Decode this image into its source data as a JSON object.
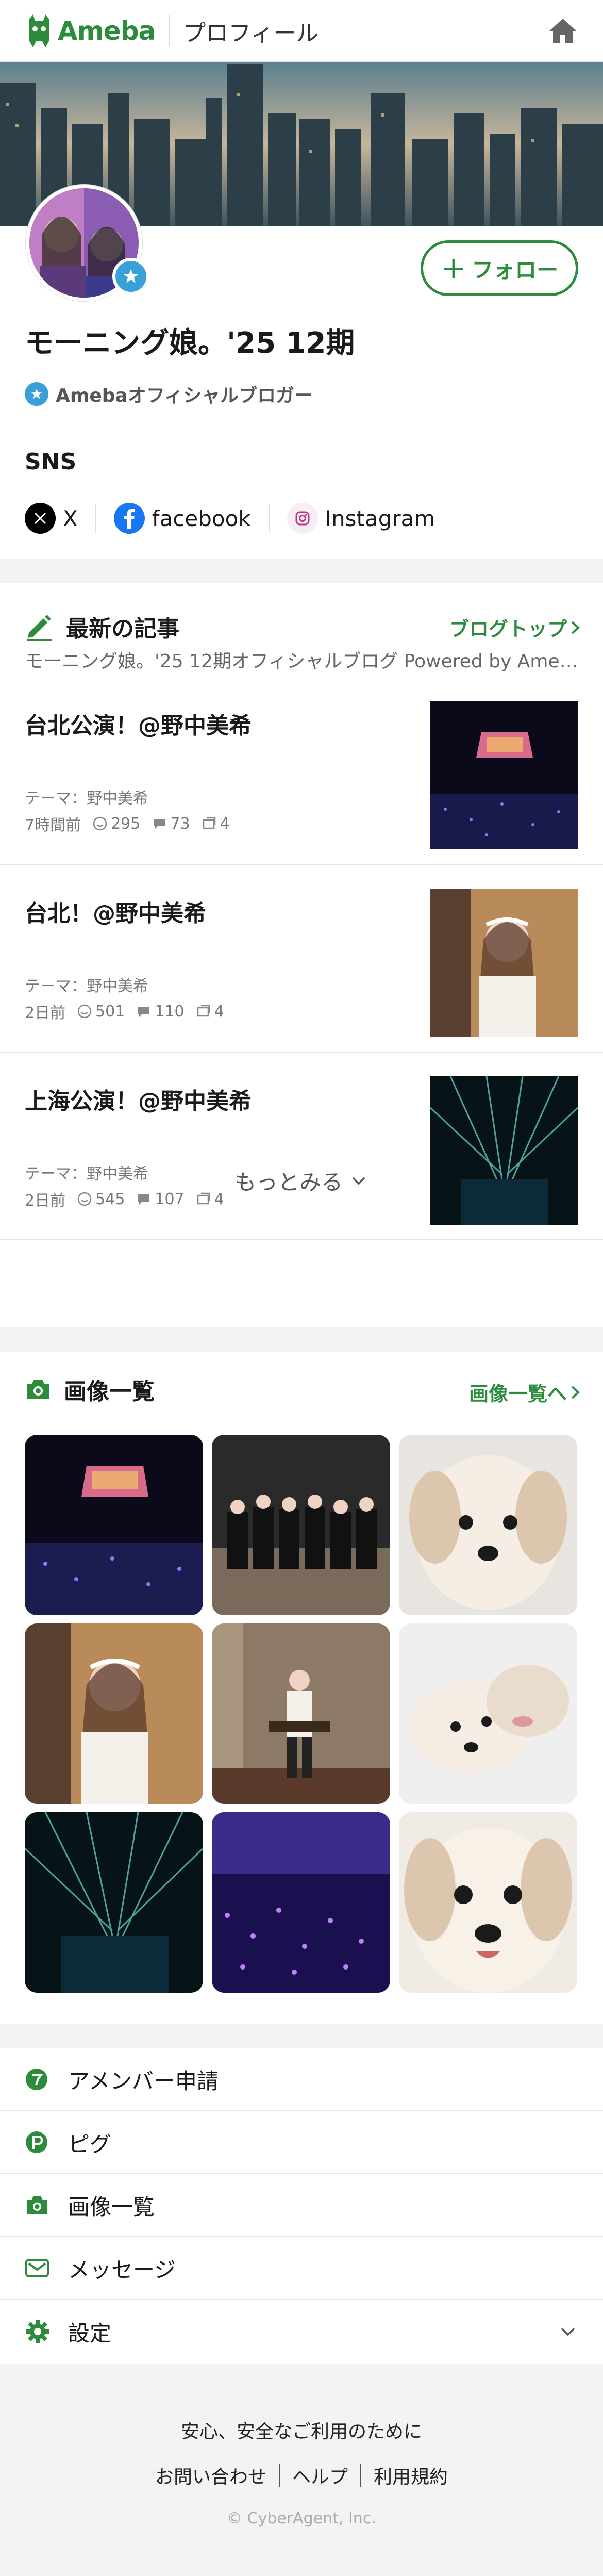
{
  "header": {
    "logo_text": "Ameba",
    "title": "プロフィール"
  },
  "profile": {
    "follow_label": "フォロー",
    "name": "モーニング娘。'25 12期",
    "official_label": "Amebaオフィシャルブロガー"
  },
  "sns": {
    "title": "SNS",
    "items": [
      {
        "label": "X",
        "icon": "x-icon"
      },
      {
        "label": "facebook",
        "icon": "facebook-icon"
      },
      {
        "label": "Instagram",
        "icon": "instagram-icon"
      }
    ]
  },
  "articles": {
    "title": "最新の記事",
    "link": "ブログトップ",
    "subtitle": "モーニング娘。'25 12期オフィシャルブログ Powered by Ameba",
    "items": [
      {
        "title": "台北公演！@野中美希",
        "theme": "テーマ：野中美希",
        "time": "7時間前",
        "likes": "295",
        "comments": "73",
        "reblogs": "4"
      },
      {
        "title": "台北！@野中美希",
        "theme": "テーマ：野中美希",
        "time": "2日前",
        "likes": "501",
        "comments": "110",
        "reblogs": "4"
      },
      {
        "title": "上海公演！@野中美希",
        "theme": "テーマ：野中美希",
        "time": "2日前",
        "likes": "545",
        "comments": "107",
        "reblogs": "4"
      }
    ],
    "more_label": "もっとみる"
  },
  "images": {
    "title": "画像一覧",
    "link": "画像一覧へ"
  },
  "menu": {
    "items": [
      {
        "label": "アメンバー申請",
        "icon": "amember-icon"
      },
      {
        "label": "ピグ",
        "icon": "pigg-icon"
      },
      {
        "label": "画像一覧",
        "icon": "camera-icon"
      },
      {
        "label": "メッセージ",
        "icon": "message-icon"
      },
      {
        "label": "設定",
        "icon": "gear-icon"
      }
    ]
  },
  "footer": {
    "safety": "安心、安全なご利用のために",
    "links": [
      "お問い合わせ",
      "ヘルプ",
      "利用規約"
    ],
    "copyright": "© CyberAgent, Inc."
  },
  "colors": {
    "brand_green": "#2d8c3c",
    "official_blue": "#3aa0d8"
  }
}
